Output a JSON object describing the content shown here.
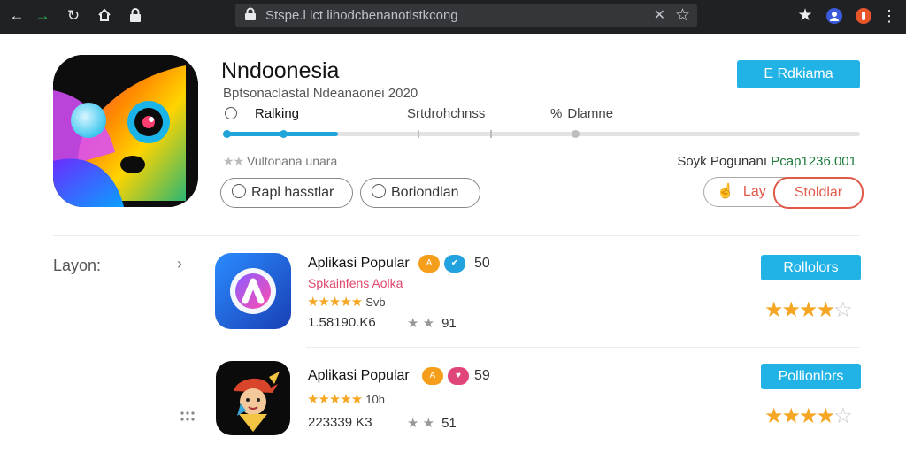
{
  "browser": {
    "url": "Stspe.l lct lihodcbenanotlstkcong"
  },
  "hero": {
    "title": "Nndoonesia",
    "subtitle": "Bptsonaclastal Ndeanaonei 2020",
    "tabs": [
      "Ralking",
      "Srtdrohchnss",
      "Dlamne"
    ],
    "progress": 0.18,
    "rating_text": "Vultonana unara",
    "stats_prefix": "Soyk Pogunanı ",
    "stats_value": "Pcap1236.001",
    "pills": [
      "Rapl hasstlar",
      "Boriondlan"
    ],
    "like_label": "Lay",
    "stop_label": "Stoldlar",
    "top_button": "E Rdkiama"
  },
  "section": {
    "label": "Layon:"
  },
  "apps": [
    {
      "name": "Aplikasi Popular",
      "subtitle": "Spkainfens Aolka",
      "subtitle_color": "#e0466a",
      "badge1": "A",
      "badge1_color": "#f59e1b",
      "badge2_icon": "check-icon",
      "badge2_color": "#22a2df",
      "badge_count": "50",
      "stars_label": "Svb",
      "size": "1.58190.K6",
      "mini_count": "91",
      "button": "Rollolors",
      "rating": 4
    },
    {
      "name": "Aplikasi Popular",
      "subtitle": "",
      "subtitle_color": "#e0466a",
      "badge1": "A",
      "badge1_color": "#f59e1b",
      "badge2_icon": "heart-icon",
      "badge2_color": "#e0467a",
      "badge_count": "59",
      "stars_label": "10h",
      "size": "223339 K3",
      "mini_count": "51",
      "button": "Pollionlors",
      "rating": 4
    }
  ],
  "colors": {
    "accent": "#22b3e6",
    "star": "#f5a623",
    "stop": "#e05a4a"
  }
}
